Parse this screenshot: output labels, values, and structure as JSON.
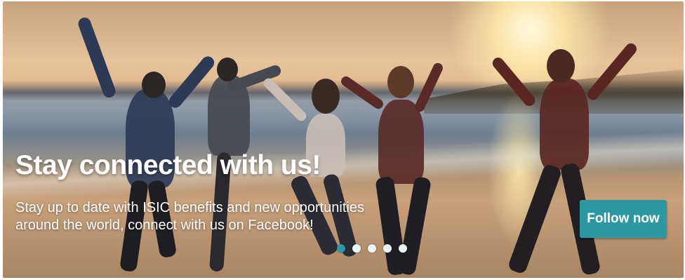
{
  "banner": {
    "headline": "Stay connected with us!",
    "subtext_line1": "Stay up to date with ISIC benefits and new opportunities",
    "subtext_line2": "around the world, connect with us on Facebook!",
    "cta_label": "Follow now",
    "image_description": "silhouettes-jumping-on-beach-at-sunset",
    "accent_color": "#2b98a3"
  },
  "carousel": {
    "total_slides": 5,
    "active_index": 0
  }
}
